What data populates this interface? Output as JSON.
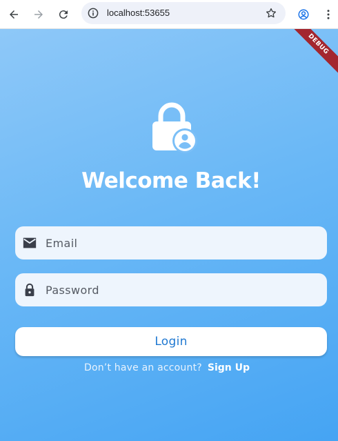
{
  "browser": {
    "url": "localhost:53655"
  },
  "app": {
    "debug_banner": "DEBUG",
    "title": "Welcome Back!",
    "email_placeholder": "Email",
    "password_placeholder": "Password",
    "login_label": "Login",
    "signup_prompt": "Don’t have an account?",
    "signup_link": "Sign Up",
    "colors": {
      "gradient_top": "#8ec8f8",
      "gradient_bottom": "#45a4f3",
      "field_bg": "#eef5fd",
      "button_text": "#1f78d1",
      "debug_banner": "#a3262f"
    },
    "icons": [
      "lock-person-icon",
      "email-icon",
      "lock-icon"
    ]
  }
}
